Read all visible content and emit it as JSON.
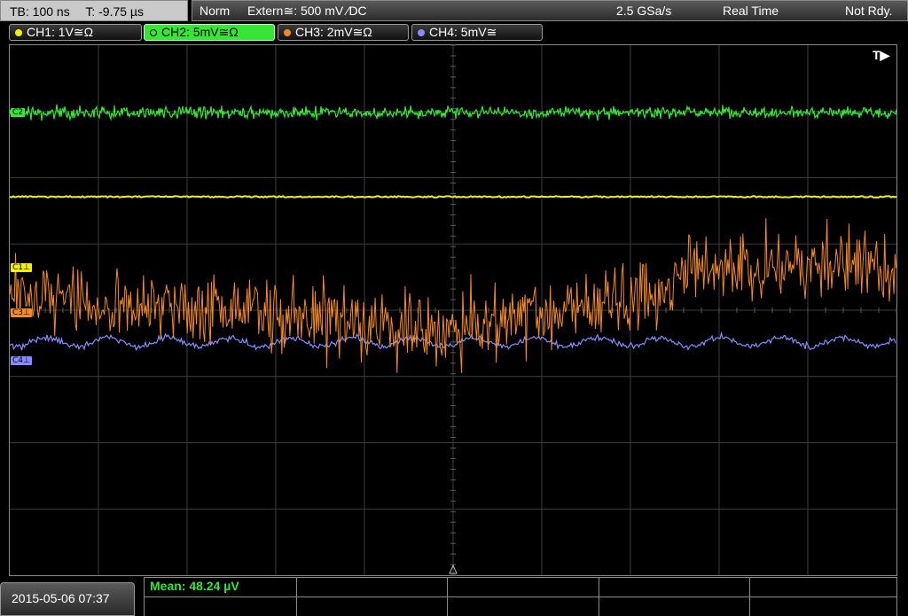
{
  "header": {
    "timebase": "TB: 100 ns",
    "trigger_time": "T: -9.75 µs",
    "mode": "Norm",
    "trigger_source": "Extern≅: 500 mV ⁄DC",
    "sample_rate": "2.5 GSa/s",
    "acq_mode": "Real Time",
    "state": "Not Rdy."
  },
  "channels": [
    {
      "label": "CH1: 1V≅Ω",
      "color": "#f2f200",
      "active": false
    },
    {
      "label": "CH2: 5mV≅Ω",
      "color": "#36e536",
      "active": true
    },
    {
      "label": "CH3: 2mV≅Ω",
      "color": "#f28a2a",
      "active": false
    },
    {
      "label": "CH4: 5mV≅",
      "color": "#8a8aff",
      "active": false
    }
  ],
  "markers": {
    "c2": "C2",
    "c1": "C1⊥",
    "c3": "C3⊥",
    "c4": "C4⊥",
    "trigger": "T▶"
  },
  "footer": {
    "datetime": "2015-05-06 07:37",
    "measurement": "Mean: 48.24 µV"
  },
  "colors": {
    "ch1": "#f2f200",
    "ch2": "#36e536",
    "ch3": "#f28a2a",
    "ch4": "#8a8aff",
    "grid": "#3c3c3c"
  }
}
